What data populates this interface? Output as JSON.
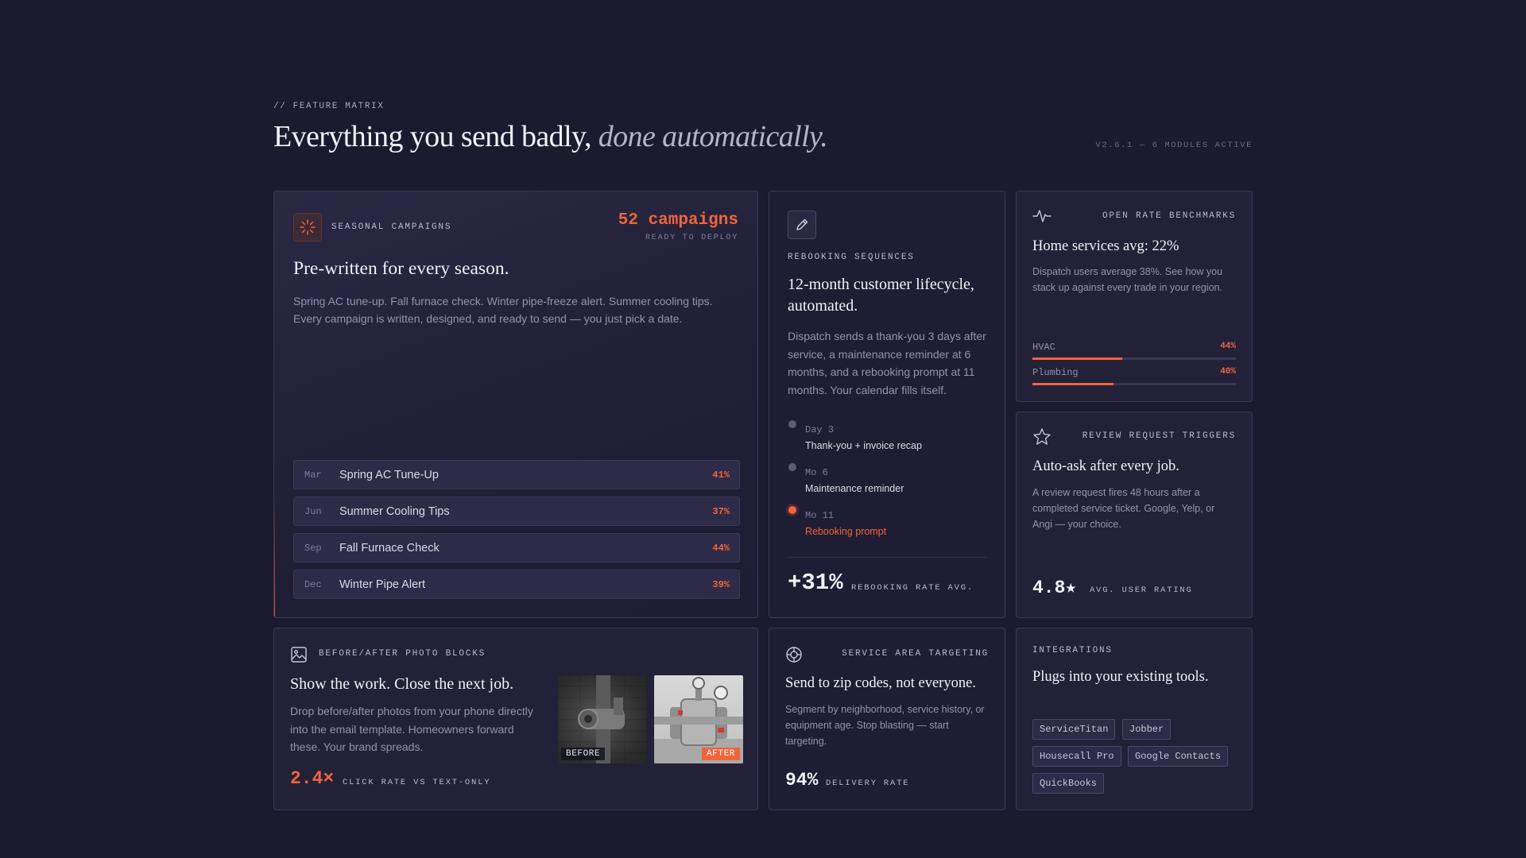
{
  "header": {
    "eyebrow": "// FEATURE MATRIX",
    "headline_main": "Everything you send badly,",
    "headline_italic": "done automatically.",
    "version": "V2.6.1 — 6 MODULES ACTIVE"
  },
  "colors": {
    "accent": "#f0643c",
    "background": "#1b1a2e",
    "card": "#232138"
  },
  "seasonal": {
    "icon": "sun-icon",
    "label": "SEASONAL CAMPAIGNS",
    "count": "52 campaigns",
    "count_sub": "READY TO DEPLOY",
    "title": "Pre-written for every season.",
    "body": "Spring AC tune-up. Fall furnace check. Winter pipe-freeze alert. Summer cooling tips. Every campaign is written, designed, and ready to send — you just pick a date.",
    "rows": [
      {
        "month": "Mar",
        "name": "Spring AC Tune-Up",
        "pct": "41%"
      },
      {
        "month": "Jun",
        "name": "Summer Cooling Tips",
        "pct": "37%"
      },
      {
        "month": "Sep",
        "name": "Fall Furnace Check",
        "pct": "44%"
      },
      {
        "month": "Dec",
        "name": "Winter Pipe Alert",
        "pct": "39%"
      }
    ]
  },
  "rebooking": {
    "icon": "pencil-icon",
    "label": "REBOOKING SEQUENCES",
    "title": "12-month customer lifecycle, automated.",
    "body": "Dispatch sends a thank-you 3 days after service, a maintenance reminder at 6 months, and a rebooking prompt at 11 months. Your calendar fills itself.",
    "timeline": [
      {
        "day": "Day 3",
        "text": "Thank-you + invoice recap"
      },
      {
        "day": "Mo 6",
        "text": "Maintenance reminder"
      },
      {
        "day": "Mo 11",
        "text": "Rebooking prompt"
      }
    ],
    "stat": "+31%",
    "stat_label": "REBOOKING RATE AVG."
  },
  "benchmarks": {
    "icon": "pulse-icon",
    "label": "OPEN RATE BENCHMARKS",
    "title": "Home services avg: 22%",
    "body": "Dispatch users average 38%. See how you stack up against every trade in your region.",
    "bars": [
      {
        "name": "HVAC",
        "value_label": "44%",
        "value": 0.44
      },
      {
        "name": "Plumbing",
        "value_label": "40%",
        "value": 0.4
      }
    ]
  },
  "reviews": {
    "icon": "star-icon",
    "label": "REVIEW REQUEST TRIGGERS",
    "title": "Auto-ask after every job.",
    "body": "A review request fires 48 hours after a completed service ticket. Google, Yelp, or Angi — your choice.",
    "stat": "4.8★",
    "stat_label": "AVG. USER RATING"
  },
  "photos": {
    "icon": "image-icon",
    "label": "BEFORE/AFTER PHOTO BLOCKS",
    "title": "Show the work. Close the next job.",
    "body": "Drop before/after photos from your phone directly into the email template. Homeowners forward these. Your brand spreads.",
    "before_tag": "BEFORE",
    "after_tag": "AFTER",
    "stat": "2.4×",
    "stat_label": "CLICK RATE VS TEXT-ONLY"
  },
  "targeting": {
    "icon": "target-icon",
    "label": "SERVICE AREA TARGETING",
    "title": "Send to zip codes, not everyone.",
    "body": "Segment by neighborhood, service history, or equipment age. Stop blasting — start targeting.",
    "stat": "94%",
    "stat_label": "DELIVERY RATE"
  },
  "integrations": {
    "label": "INTEGRATIONS",
    "title": "Plugs into your existing tools.",
    "chips": [
      "ServiceTitan",
      "Jobber",
      "Housecall Pro",
      "Google Contacts",
      "QuickBooks"
    ]
  }
}
